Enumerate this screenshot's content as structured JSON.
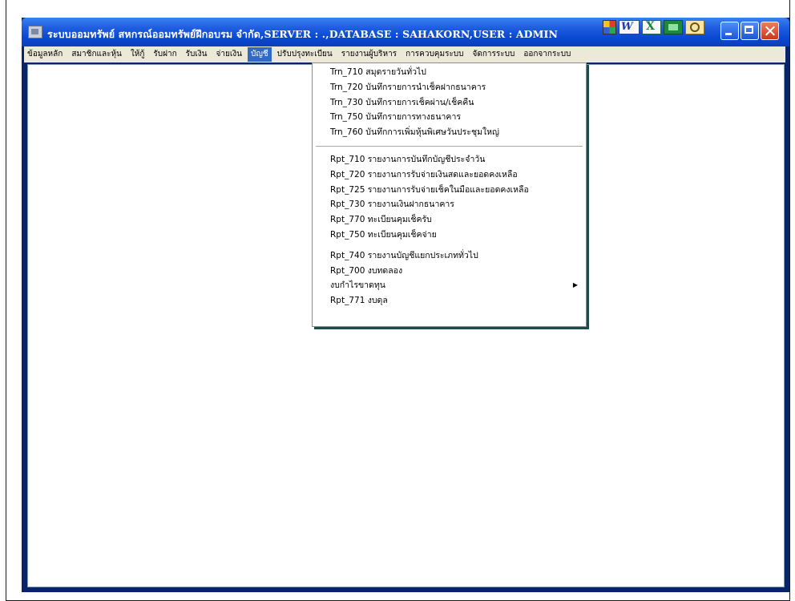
{
  "window": {
    "title": "ระบบออมทรัพย์ สหกรณ์ออมทรัพย์ฝึกอบรม จำกัด,SERVER : .,DATABASE : SAHAKORN,USER : ADMIN",
    "toolbar_icons": [
      "excel-grid-icon",
      "word-icon",
      "excel-icon",
      "monitor-icon",
      "search-icon"
    ]
  },
  "menubar": {
    "items": [
      {
        "label": "ข้อมูลหลัก"
      },
      {
        "label": "สมาชิกและหุ้น"
      },
      {
        "label": "ให้กู้"
      },
      {
        "label": "รับฝาก"
      },
      {
        "label": "รับเงิน"
      },
      {
        "label": "จ่ายเงิน"
      },
      {
        "label": "บัญชี",
        "active": true
      },
      {
        "label": "ปรับปรุงทะเบียน"
      },
      {
        "label": "รายงานผู้บริหาร"
      },
      {
        "label": "การควบคุมระบบ"
      },
      {
        "label": "จัดการระบบ"
      },
      {
        "label": "ออกจากระบบ"
      }
    ]
  },
  "dropdown": {
    "group1": [
      "Trn_710 สมุดรายวันทั่วไป",
      "Trn_720 บันทึกรายการนำเช็คฝากธนาคาร",
      "Trn_730 บันทึกรายการเช็คผ่าน/เช็คคืน",
      "Trn_750 บันทึกรายการทางธนาคาร",
      "Trn_760 บันทึกการเพิ่มหุ้นพิเศษวันประชุมใหญ่"
    ],
    "group2": [
      "Rpt_710 รายงานการบันทึกบัญชีประจำวัน",
      "Rpt_720 รายงานการรับจ่ายเงินสดและยอดคงเหลือ",
      "Rpt_725 รายงานการรับจ่ายเช็คในมือและยอดคงเหลือ",
      "Rpt_730 รายงานเงินฝากธนาคาร",
      "Rpt_770 ทะเบียนคุมเช็ครับ",
      "Rpt_750 ทะเบียนคุมเช็คจ่าย"
    ],
    "group3": [
      "Rpt_740 รายงานบัญชีแยกประเภททั่วไป",
      "Rpt_700 งบทดลอง",
      "งบกำไรขาดทุน",
      "Rpt_771 งบดุล"
    ],
    "submenu_indicator": "▶"
  }
}
